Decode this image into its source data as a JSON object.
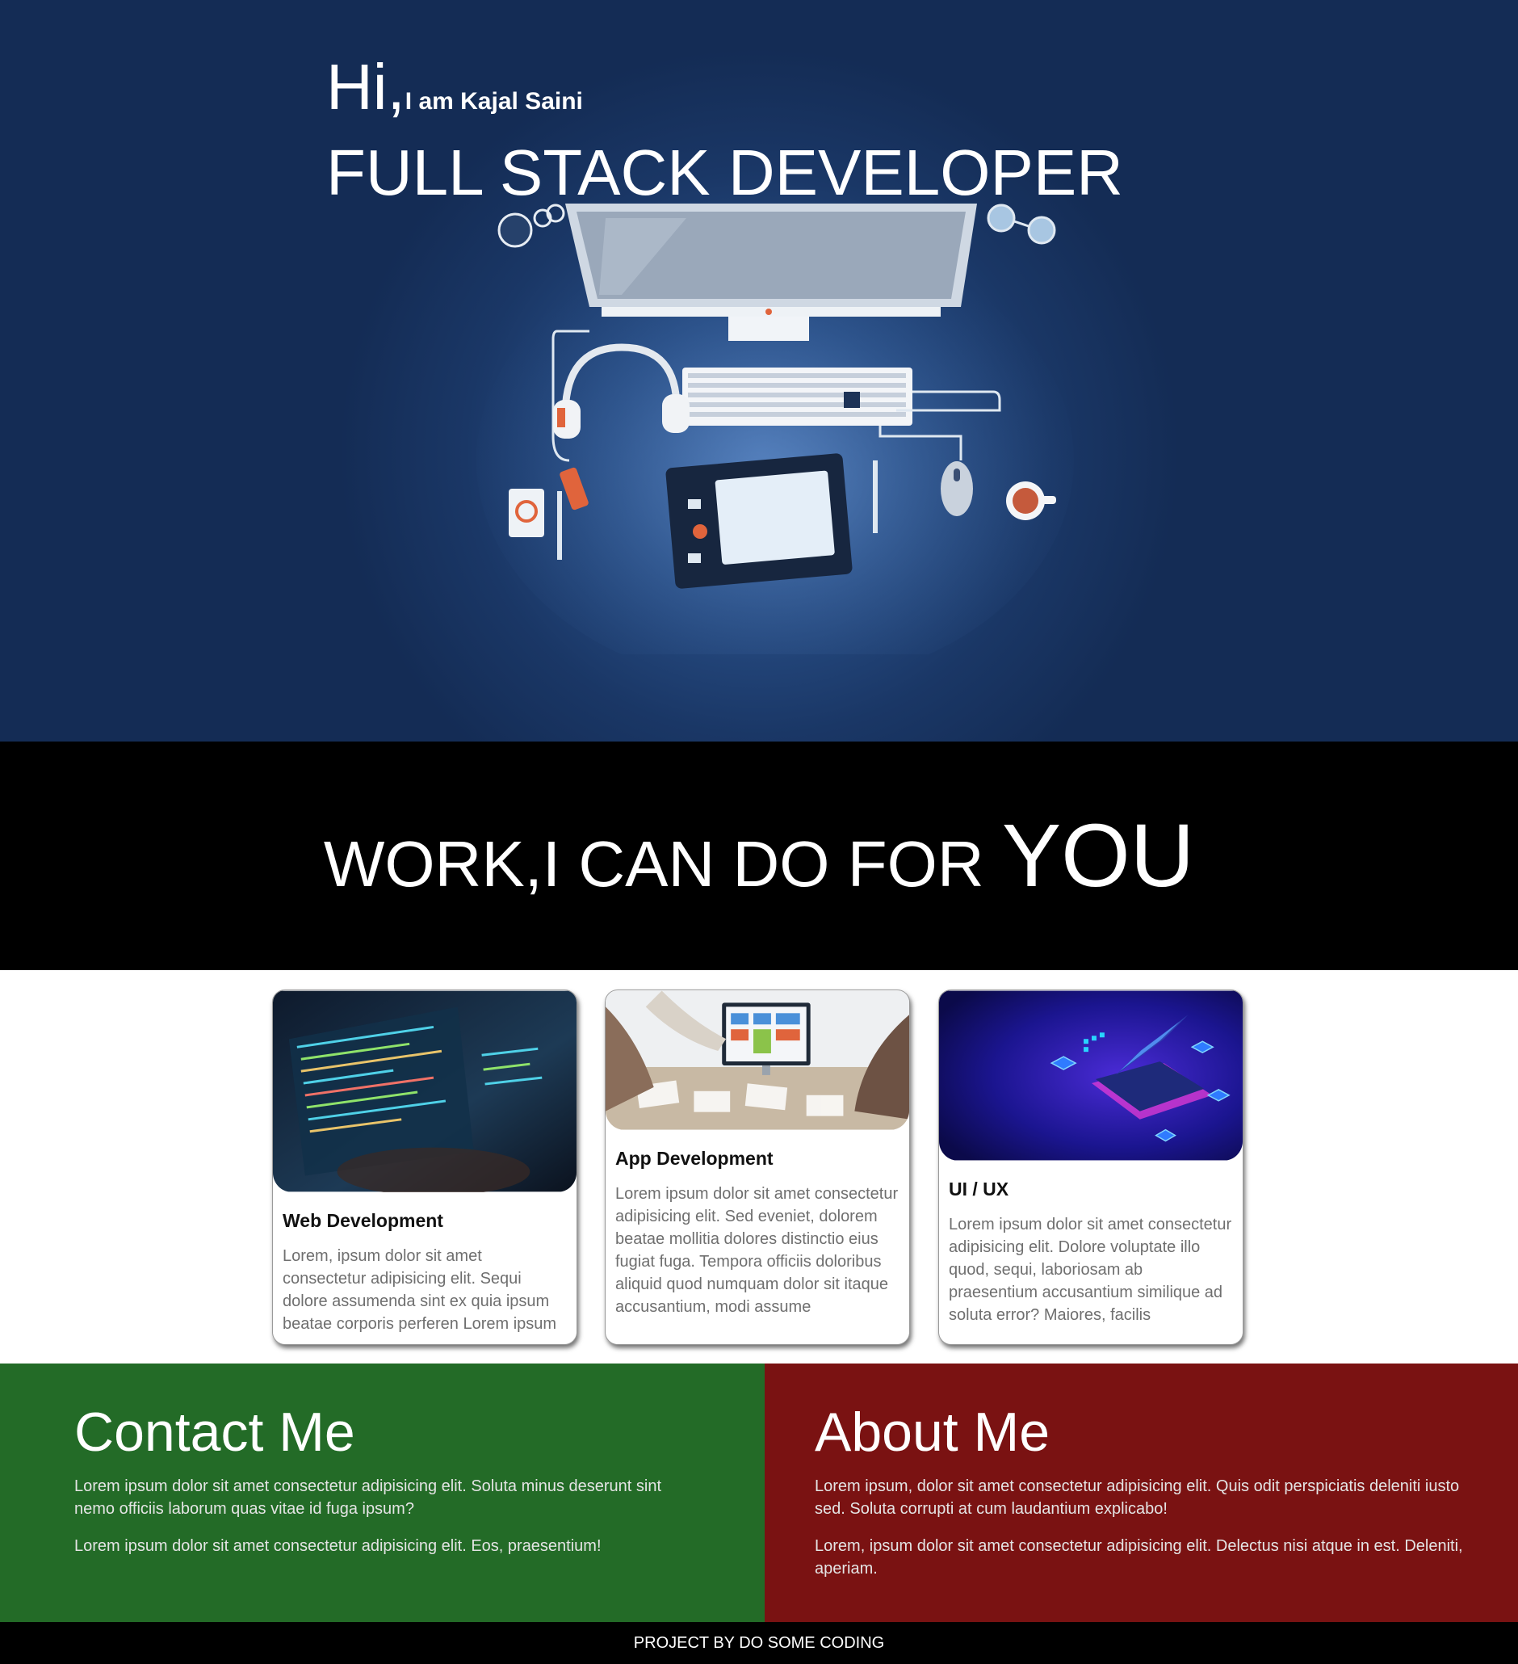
{
  "hero": {
    "hi": "Hi,",
    "intro": "I am Kajal Saini",
    "role": "FULL STACK DEVELOPER",
    "illustration_icon": "developer-desk-illustration"
  },
  "work": {
    "title_main": "WORK,I CAN DO FOR ",
    "title_emphasis": "YOU"
  },
  "cards": [
    {
      "title": "Web Development",
      "text": "Lorem, ipsum dolor sit amet consectetur adipisicing elit. Sequi dolore assumenda sint ex quia ipsum beatae corporis perferen Lorem ipsum",
      "image_icon": "coding-screen-image"
    },
    {
      "title": "App Development",
      "text": "Lorem ipsum dolor sit amet consectetur adipisicing elit. Sed eveniet, dolorem beatae mollitia dolores distinctio eius fugiat fuga. Tempora officiis doloribus aliquid quod numquam dolor sit itaque accusantium, modi assume",
      "image_icon": "team-app-design-image"
    },
    {
      "title": "UI / UX",
      "text": "Lorem ipsum dolor sit amet consectetur adipisicing elit. Dolore voluptate illo quod, sequi, laboriosam ab praesentium accusantium similique ad soluta error? Maiores, facilis",
      "image_icon": "isometric-laptop-image"
    }
  ],
  "contact": {
    "title": "Contact Me",
    "paragraphs": [
      "Lorem ipsum dolor sit amet consectetur adipisicing elit. Soluta minus deserunt sint nemo officiis laborum quas vitae id fuga ipsum?",
      "Lorem ipsum dolor sit amet consectetur adipisicing elit. Eos, praesentium!"
    ]
  },
  "about": {
    "title": "About Me",
    "paragraphs": [
      "Lorem ipsum, dolor sit amet consectetur adipisicing elit. Quis odit perspiciatis deleniti iusto sed. Soluta corrupti at cum laudantium explicabo!",
      "Lorem, ipsum dolor sit amet consectetur adipisicing elit. Delectus nisi atque in est. Deleniti, aperiam."
    ]
  },
  "footer": {
    "text": "PROJECT BY DO SOME CODING"
  },
  "colors": {
    "hero_bg": "#1a3766",
    "work_bg": "#000000",
    "contact_bg": "#236b27",
    "about_bg": "#7a1212",
    "footer_bg": "#000000"
  }
}
